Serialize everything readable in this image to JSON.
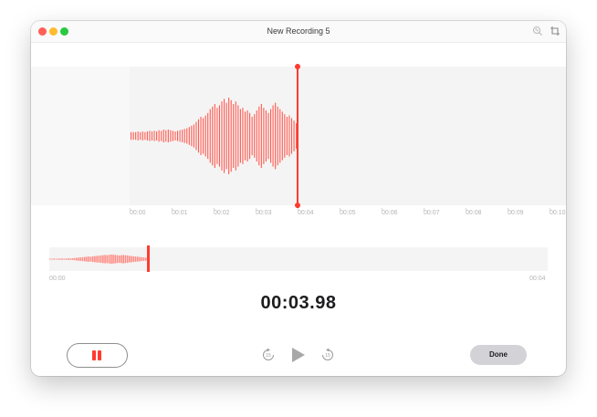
{
  "window": {
    "title": "New Recording 5"
  },
  "toolbar": {
    "icons": [
      "enhance-recording-icon",
      "trim-icon"
    ]
  },
  "waveform": {
    "time_labels": [
      "00:00",
      "00:01",
      "00:02",
      "00:03",
      "00:04",
      "00:05",
      "00:06",
      "00:07",
      "00:08",
      "00:09",
      "00:10"
    ],
    "amplitudes": [
      0.06,
      0.06,
      0.06,
      0.07,
      0.06,
      0.07,
      0.06,
      0.07,
      0.08,
      0.07,
      0.08,
      0.07,
      0.09,
      0.08,
      0.1,
      0.09,
      0.1,
      0.09,
      0.08,
      0.07,
      0.08,
      0.09,
      0.1,
      0.11,
      0.12,
      0.14,
      0.16,
      0.18,
      0.22,
      0.26,
      0.3,
      0.28,
      0.32,
      0.36,
      0.42,
      0.46,
      0.5,
      0.44,
      0.48,
      0.54,
      0.58,
      0.52,
      0.6,
      0.56,
      0.5,
      0.54,
      0.48,
      0.42,
      0.44,
      0.38,
      0.4,
      0.36,
      0.3,
      0.34,
      0.4,
      0.46,
      0.5,
      0.44,
      0.4,
      0.36,
      0.42,
      0.48,
      0.52,
      0.46,
      0.42,
      0.38,
      0.34,
      0.3,
      0.32,
      0.28,
      0.24,
      0.2
    ],
    "color": "#ff5a50",
    "playhead_color": "#ff3b30"
  },
  "overview": {
    "start_label": "00:00",
    "end_label": "00:04",
    "progress": 0.2,
    "amplitudes": [
      0.04,
      0.04,
      0.05,
      0.04,
      0.05,
      0.05,
      0.06,
      0.05,
      0.06,
      0.07,
      0.06,
      0.08,
      0.1,
      0.12,
      0.14,
      0.16,
      0.18,
      0.2,
      0.22,
      0.24,
      0.22,
      0.26,
      0.28,
      0.3,
      0.32,
      0.34,
      0.36,
      0.38,
      0.36,
      0.4,
      0.42,
      0.4,
      0.38,
      0.36,
      0.34,
      0.36,
      0.38,
      0.36,
      0.34,
      0.3,
      0.28,
      0.26,
      0.24,
      0.22,
      0.2,
      0.18,
      0.16,
      0.14
    ]
  },
  "elapsed_time": "00:03.98",
  "controls": {
    "done_label": "Done"
  }
}
